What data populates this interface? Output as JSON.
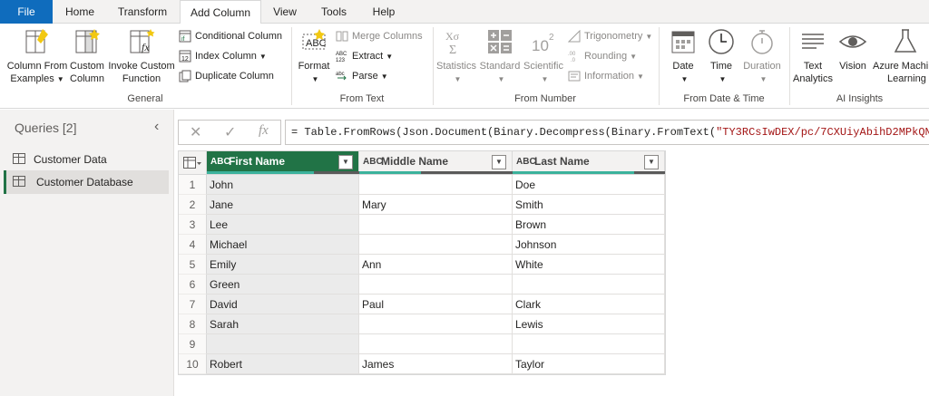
{
  "menu": {
    "tabs": [
      {
        "label": "File"
      },
      {
        "label": "Home"
      },
      {
        "label": "Transform"
      },
      {
        "label": "Add Column"
      },
      {
        "label": "View"
      },
      {
        "label": "Tools"
      },
      {
        "label": "Help"
      }
    ]
  },
  "ribbon": {
    "general": {
      "group_label": "General",
      "column_from_examples": [
        "Column From",
        "Examples"
      ],
      "custom_column": [
        "Custom",
        "Column"
      ],
      "invoke_custom_function": [
        "Invoke Custom",
        "Function"
      ],
      "conditional_column": "Conditional Column",
      "index_column": "Index Column",
      "duplicate_column": "Duplicate Column"
    },
    "from_text": {
      "group_label": "From Text",
      "format": "Format",
      "merge_columns": "Merge Columns",
      "extract": "Extract",
      "parse": "Parse"
    },
    "from_number": {
      "group_label": "From Number",
      "statistics": "Statistics",
      "standard": "Standard",
      "scientific": "Scientific",
      "trigonometry": "Trigonometry",
      "rounding": "Rounding",
      "information": "Information"
    },
    "from_date_time": {
      "group_label": "From Date & Time",
      "date": "Date",
      "time": "Time",
      "duration": "Duration"
    },
    "ai_insights": {
      "group_label": "AI Insights",
      "text_analytics": [
        "Text",
        "Analytics"
      ],
      "vision": "Vision",
      "azure_ml": [
        "Azure Machi",
        "Learning"
      ]
    }
  },
  "queries": {
    "title": "Queries [2]",
    "items": [
      {
        "label": "Customer Data",
        "selected": false
      },
      {
        "label": "Customer Database",
        "selected": true
      }
    ]
  },
  "formula": {
    "prefix": "= Table.FromRows(Json.Document(Binary.Decompress(Binary.FromText(",
    "string": "\"TY3RCsIwDEX/pc/7CXUiyAbihD2MPkQNNN"
  },
  "table": {
    "columns": [
      {
        "name": "First Name",
        "type_icon": "ABC",
        "selected": true
      },
      {
        "name": "Middle Name",
        "type_icon": "ABC",
        "selected": false
      },
      {
        "name": "Last Name",
        "type_icon": "ABC",
        "selected": false
      }
    ],
    "rows": [
      {
        "n": "1",
        "first": "John",
        "middle": "",
        "last": "Doe"
      },
      {
        "n": "2",
        "first": "Jane",
        "middle": "Mary",
        "last": "Smith"
      },
      {
        "n": "3",
        "first": "Lee",
        "middle": "",
        "last": "Brown"
      },
      {
        "n": "4",
        "first": "Michael",
        "middle": "",
        "last": "Johnson"
      },
      {
        "n": "5",
        "first": "Emily",
        "middle": "Ann",
        "last": "White"
      },
      {
        "n": "6",
        "first": "Green",
        "middle": "",
        "last": ""
      },
      {
        "n": "7",
        "first": "David",
        "middle": "Paul",
        "last": "Clark"
      },
      {
        "n": "8",
        "first": "Sarah",
        "middle": "",
        "last": "Lewis"
      },
      {
        "n": "9",
        "first": "",
        "middle": "",
        "last": ""
      },
      {
        "n": "10",
        "first": "Robert",
        "middle": "James",
        "last": "Taylor"
      }
    ]
  },
  "colors": {
    "accent": "#217346",
    "file_tab": "#0f6cbd",
    "quality_valid": "#3bb29c",
    "quality_empty": "#5a5a5a"
  }
}
